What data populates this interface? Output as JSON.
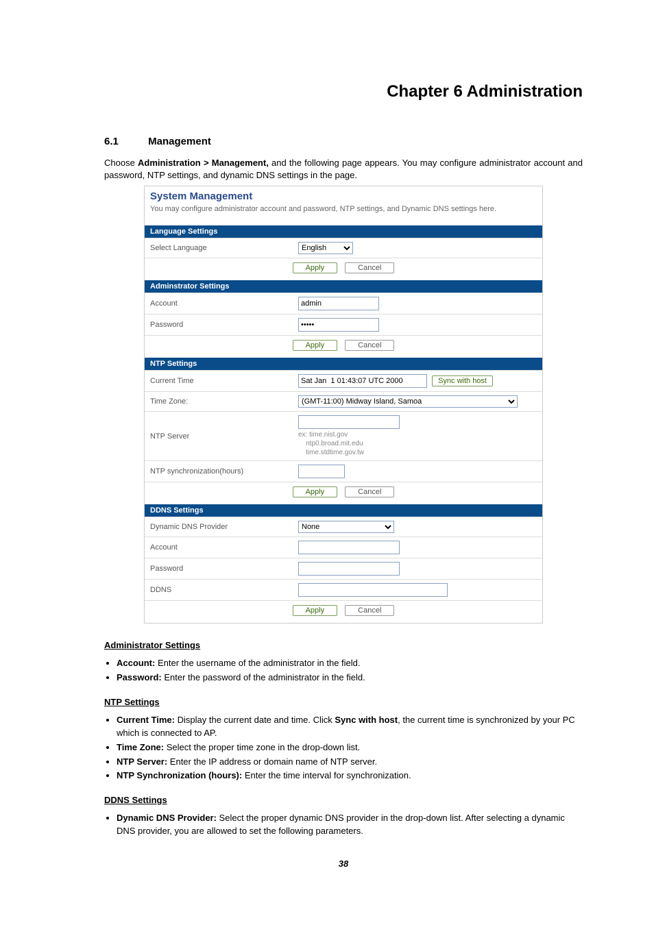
{
  "chapter": {
    "title": "Chapter 6 Administration"
  },
  "section": {
    "num": "6.1",
    "title": "Management"
  },
  "intro": {
    "line1_pre": "Choose ",
    "line1_b": "Administration > Management,",
    "line1_post": " and the following page appears. You may configure administrator account and password, NTP settings, and dynamic DNS settings in the page."
  },
  "router": {
    "title": "System Management",
    "subdesc": "You may configure administrator account and password, NTP settings, and Dynamic DNS settings here.",
    "language": {
      "bar": "Language Settings",
      "label": "Select Language",
      "value": "English",
      "apply": "Apply",
      "cancel": "Cancel"
    },
    "admin": {
      "bar": "Adminstrator Settings",
      "account_label": "Account",
      "account_value": "admin",
      "password_label": "Password",
      "password_value": "•••••",
      "apply": "Apply",
      "cancel": "Cancel"
    },
    "ntp": {
      "bar": "NTP Settings",
      "current_label": "Current Time",
      "current_value": "Sat Jan  1 01:43:07 UTC 2000",
      "sync_btn": "Sync with host",
      "tz_label": "Time Zone:",
      "tz_value": "(GMT-11:00) Midway Island, Samoa",
      "server_label": "NTP Server",
      "server_value": "",
      "hints": "ex: time.nist.gov\n    ntp0.broad.mit.edu\n    time.stdtime.gov.tw",
      "sync_hours_label": "NTP synchronization(hours)",
      "sync_hours_value": "",
      "apply": "Apply",
      "cancel": "Cancel"
    },
    "ddns": {
      "bar": "DDNS Settings",
      "provider_label": "Dynamic DNS Provider",
      "provider_value": "None",
      "account_label": "Account",
      "account_value": "",
      "password_label": "Password",
      "password_value": "",
      "ddns_label": "DDNS",
      "ddns_value": "",
      "apply": "Apply",
      "cancel": "Cancel"
    }
  },
  "doc": {
    "admin_title": "Administrator Settings",
    "admin_items": {
      "account_b": "Account:",
      "account_t": " Enter the username of the administrator in the field.",
      "password_b": "Password:",
      "password_t": " Enter the password of the administrator in the field."
    },
    "ntp_title": "NTP Settings",
    "ntp_items": {
      "i1_b1": "Current Time:",
      "i1_t1": " Display the current date and time. Click ",
      "i1_b2": "Sync with host",
      "i1_t2": ", the current time is synchronized by your PC which is connected to AP.",
      "i2_b": "Time Zone:",
      "i2_t": " Select the proper time zone in the drop-down list.",
      "i3_b": "NTP Server:",
      "i3_t": " Enter the IP address or domain name of NTP server.",
      "i4_b": "NTP Synchronization (hours):",
      "i4_t": " Enter the time interval for synchronization."
    },
    "ddns_title": "DDNS Settings",
    "ddns_items": {
      "i1_b": "Dynamic DNS Provider:",
      "i1_t": " Select the proper dynamic DNS provider in the drop-down list. After selecting a dynamic DNS provider, you are allowed to set the following parameters."
    }
  },
  "page_number": "38"
}
